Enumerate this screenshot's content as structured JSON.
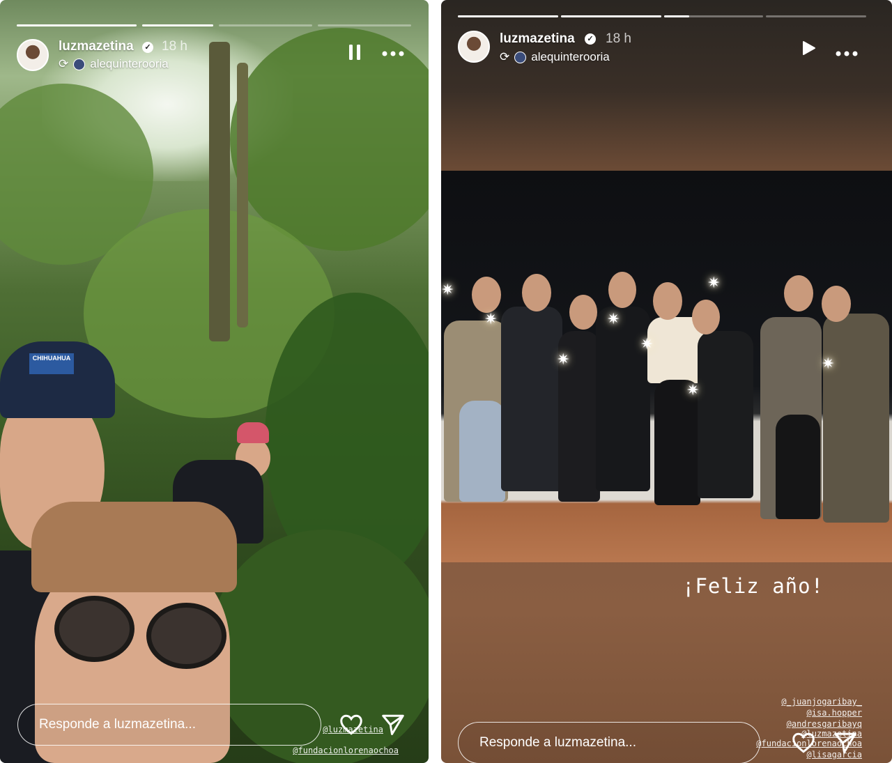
{
  "stories": [
    {
      "username": "luzmazetina",
      "time": "18 h",
      "reposted_from": "alequinterooria",
      "progress_segments": [
        1,
        0.75,
        0,
        0
      ],
      "controls": {
        "pause_icon": "pause-icon",
        "more_icon": "more-icon"
      },
      "reply_placeholder": "Responde a luzmazetina...",
      "cap_text": "CHIHUAHUA",
      "mentions": [
        "@luzmazetina",
        "@fundacionlorenaochoa"
      ]
    },
    {
      "username": "luzmazetina",
      "time": "18 h",
      "reposted_from": "alequinterooria",
      "progress_segments": [
        1,
        1,
        0.25,
        0
      ],
      "controls": {
        "play_icon": "play-icon",
        "more_icon": "more-icon"
      },
      "caption": "¡Feliz año!",
      "reply_placeholder": "Responde a luzmazetina...",
      "mentions": [
        "@_juanjogaribay_",
        "@isa.hopper",
        "@andresgaribayq",
        "@luzmazetina",
        "@fundacionlorenaochoa",
        "@lisagarcia"
      ]
    }
  ],
  "colors": {
    "foliage": "#3d5e27",
    "story_bg_right": "#7a5540",
    "accent_text": "#ffffff"
  }
}
